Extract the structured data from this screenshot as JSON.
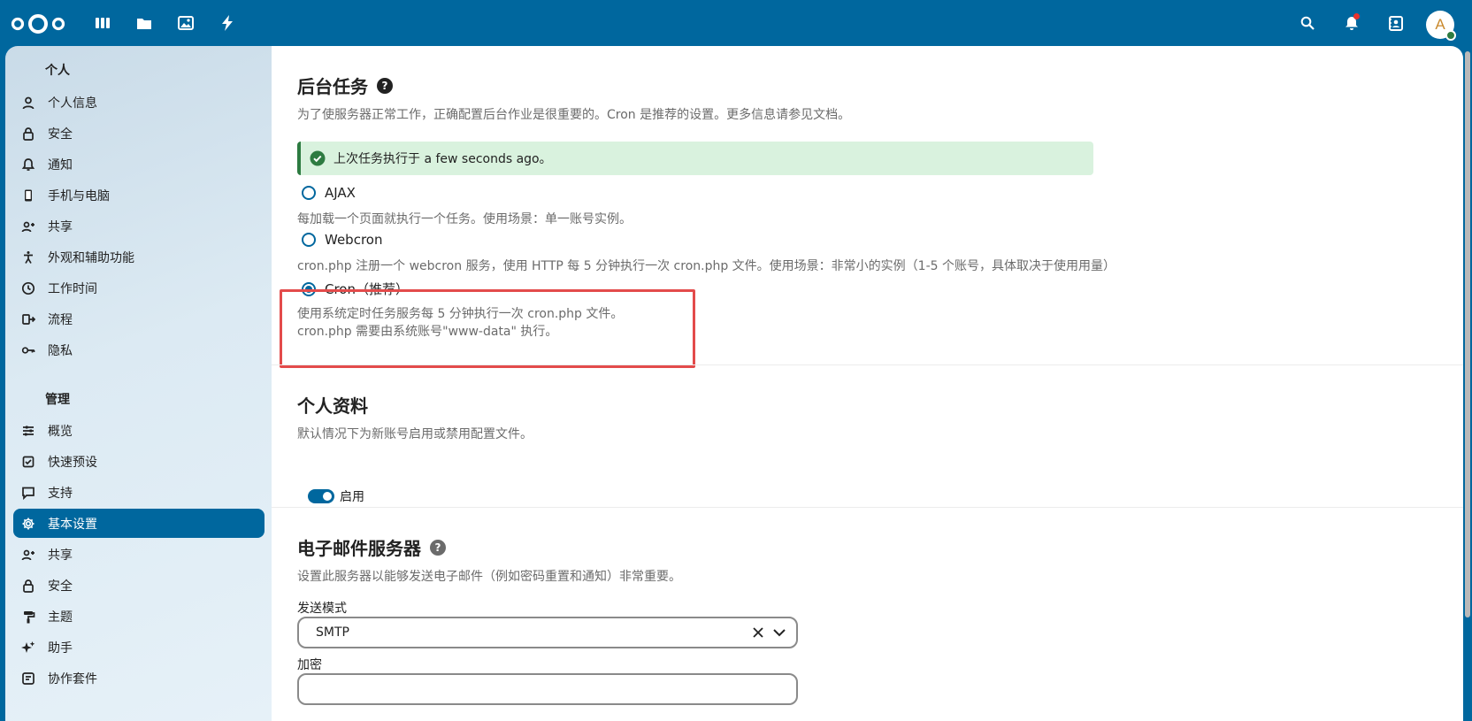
{
  "header": {
    "icons": [
      "nextcloud-logo",
      "dashboard-icon",
      "files-icon",
      "photos-icon",
      "activity-icon",
      "search-icon",
      "notifications-icon",
      "contacts-icon"
    ],
    "avatar_letter": "A"
  },
  "sidebar": {
    "personal_title": "个人",
    "personal_items": [
      {
        "label": "个人信息",
        "icon": "user-icon"
      },
      {
        "label": "安全",
        "icon": "lock-icon"
      },
      {
        "label": "通知",
        "icon": "bell-icon"
      },
      {
        "label": "手机与电脑",
        "icon": "phone-icon"
      },
      {
        "label": "共享",
        "icon": "share-icon"
      },
      {
        "label": "外观和辅助功能",
        "icon": "accessibility-icon"
      },
      {
        "label": "工作时间",
        "icon": "clock-icon"
      },
      {
        "label": "流程",
        "icon": "flow-icon"
      },
      {
        "label": "隐私",
        "icon": "key-icon"
      }
    ],
    "admin_title": "管理",
    "admin_items": [
      {
        "label": "概览",
        "icon": "overview-icon"
      },
      {
        "label": "快速预设",
        "icon": "presets-icon"
      },
      {
        "label": "支持",
        "icon": "support-icon"
      },
      {
        "label": "基本设置",
        "icon": "gear-icon",
        "active": true
      },
      {
        "label": "共享",
        "icon": "share-icon"
      },
      {
        "label": "安全",
        "icon": "lock-icon"
      },
      {
        "label": "主题",
        "icon": "paint-roller-icon"
      },
      {
        "label": "助手",
        "icon": "sparkle-icon"
      },
      {
        "label": "协作套件",
        "icon": "suite-icon"
      }
    ]
  },
  "background_jobs": {
    "title": "后台任务",
    "description": "为了使服务器正常工作，正确配置后台作业是很重要的。Cron 是推荐的设置。更多信息请参见文档。",
    "status": "上次任务执行于 a few seconds ago。",
    "options": [
      {
        "label": "AJAX",
        "description": "每加载一个页面就执行一个任务。使用场景：单一账号实例。",
        "checked": false
      },
      {
        "label": "Webcron",
        "description": "cron.php 注册一个 webcron 服务，使用 HTTP 每 5 分钟执行一次 cron.php 文件。使用场景：非常小的实例（1-5 个账号，具体取决于使用用量）",
        "checked": false
      },
      {
        "label": "Cron（推荐）",
        "description": "使用系统定时任务服务每 5 分钟执行一次 cron.php 文件。",
        "description2": "cron.php 需要由系统账号\"www-data\" 执行。",
        "checked": true
      }
    ]
  },
  "profile": {
    "title": "个人资料",
    "description": "默认情况下为新账号启用或禁用配置文件。",
    "toggle_label": "启用",
    "enabled": true
  },
  "email": {
    "title": "电子邮件服务器",
    "description": "设置此服务器以能够发送电子邮件（例如密码重置和通知）非常重要。",
    "send_mode_label": "发送模式",
    "send_mode_value": "SMTP",
    "encryption_label": "加密"
  }
}
